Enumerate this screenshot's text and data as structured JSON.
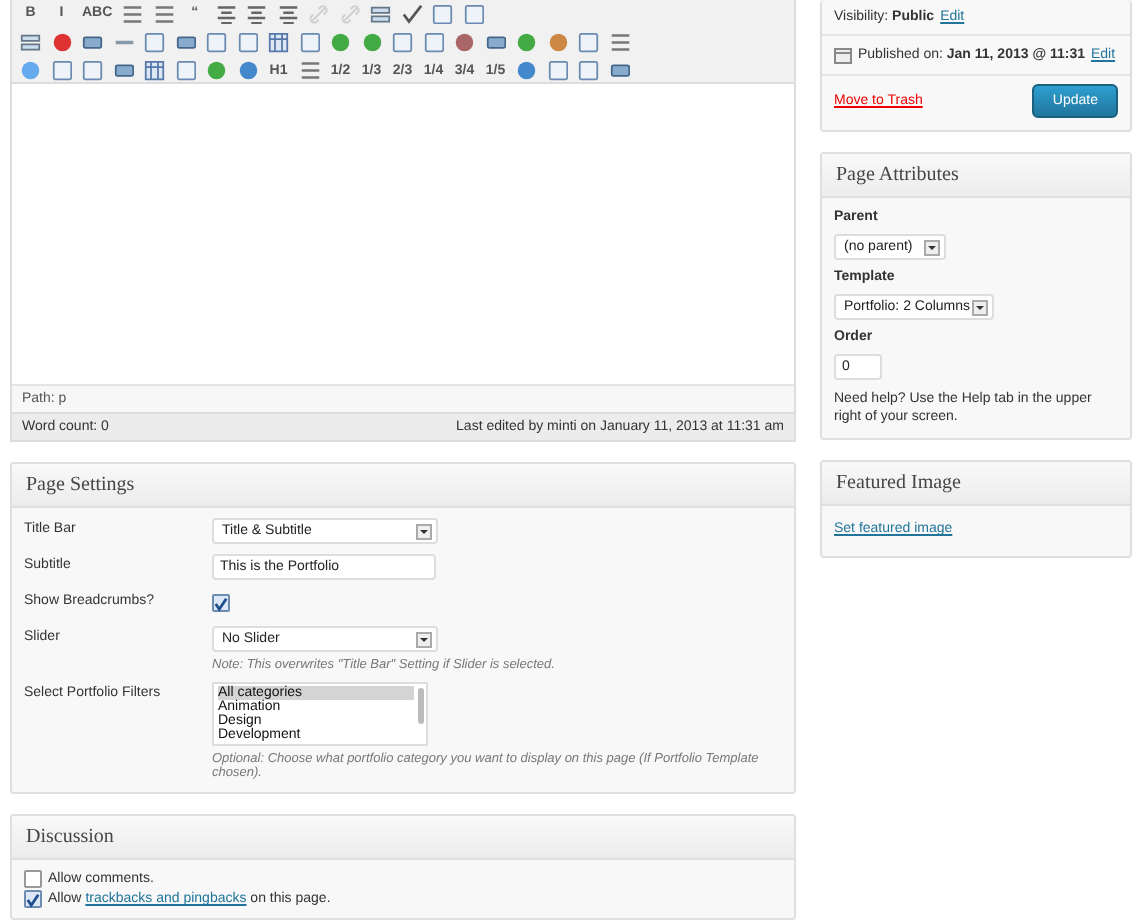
{
  "editor": {
    "toolbar": [
      [
        {
          "kind": "text",
          "label": "B"
        },
        {
          "kind": "text",
          "label": "I"
        },
        {
          "kind": "text",
          "label": "ABC"
        },
        {
          "kind": "icon"
        },
        {
          "kind": "icon"
        },
        {
          "kind": "text",
          "label": "“"
        },
        {
          "kind": "icon"
        },
        {
          "kind": "icon"
        },
        {
          "kind": "icon"
        },
        {
          "kind": "icon",
          "disabled": true
        },
        {
          "kind": "icon",
          "disabled": true
        },
        {
          "kind": "icon"
        },
        {
          "kind": "icon"
        },
        {
          "kind": "icon"
        },
        {
          "kind": "icon"
        }
      ],
      [
        {
          "kind": "icon"
        },
        {
          "kind": "icon"
        },
        {
          "kind": "icon"
        },
        {
          "kind": "icon"
        },
        {
          "kind": "icon"
        },
        {
          "kind": "icon"
        },
        {
          "kind": "icon"
        },
        {
          "kind": "icon"
        },
        {
          "kind": "icon"
        },
        {
          "kind": "icon"
        },
        {
          "kind": "icon"
        },
        {
          "kind": "icon"
        },
        {
          "kind": "icon"
        },
        {
          "kind": "icon"
        },
        {
          "kind": "icon"
        },
        {
          "kind": "icon"
        },
        {
          "kind": "icon"
        },
        {
          "kind": "icon"
        },
        {
          "kind": "icon"
        },
        {
          "kind": "icon"
        }
      ],
      [
        {
          "kind": "icon"
        },
        {
          "kind": "icon"
        },
        {
          "kind": "icon"
        },
        {
          "kind": "icon"
        },
        {
          "kind": "icon"
        },
        {
          "kind": "icon"
        },
        {
          "kind": "icon"
        },
        {
          "kind": "icon"
        },
        {
          "kind": "text",
          "label": "H1"
        },
        {
          "kind": "icon"
        },
        {
          "kind": "text",
          "label": "1/2"
        },
        {
          "kind": "text",
          "label": "1/3"
        },
        {
          "kind": "text",
          "label": "2/3"
        },
        {
          "kind": "text",
          "label": "1/4"
        },
        {
          "kind": "text",
          "label": "3/4"
        },
        {
          "kind": "text",
          "label": "1/5"
        },
        {
          "kind": "icon"
        },
        {
          "kind": "icon"
        },
        {
          "kind": "icon"
        },
        {
          "kind": "icon"
        }
      ]
    ],
    "path": "Path: p",
    "word_count": "Word count: 0",
    "last_edited": "Last edited by minti on January 11, 2013 at 11:31 am"
  },
  "page_settings": {
    "title": "Page Settings",
    "fields": [
      {
        "kind": "select",
        "label": "Title Bar",
        "value": "Title & Subtitle"
      },
      {
        "kind": "text",
        "label": "Subtitle",
        "value": "This is the Portfolio"
      },
      {
        "kind": "checkbox",
        "label": "Show Breadcrumbs?",
        "checked": true
      },
      {
        "kind": "select",
        "label": "Slider",
        "value": "No Slider",
        "note": "Note: This overwrites \"Title Bar\" Setting if Slider is selected."
      },
      {
        "kind": "listbox",
        "label": "Select Portfolio Filters",
        "options": [
          {
            "label": "All categories",
            "selected": true
          },
          {
            "label": "Animation",
            "selected": false
          },
          {
            "label": "Design",
            "selected": false
          },
          {
            "label": "Development",
            "selected": false
          }
        ],
        "note": "Optional: Choose what portfolio category you want to display on this page (If Portfolio Template chosen)."
      }
    ]
  },
  "discussion": {
    "title": "Discussion",
    "options": [
      {
        "before": "Allow comments.",
        "checked": false
      },
      {
        "before": "Allow ",
        "link": "trackbacks and pingbacks",
        "after": " on this page.",
        "checked": true
      }
    ]
  },
  "publish": {
    "visibility_label": "Visibility:",
    "visibility_value": "Public",
    "visibility_edit": "Edit",
    "published_label": "Published on:",
    "published_value": "Jan 11, 2013 @ 11:31",
    "published_edit": "Edit",
    "trash": "Move to Trash",
    "update": "Update"
  },
  "page_attributes": {
    "title": "Page Attributes",
    "parent_label": "Parent",
    "parent_value": "(no parent)",
    "template_label": "Template",
    "template_value": "Portfolio: 2 Columns",
    "order_label": "Order",
    "order_value": "0",
    "help": "Need help? Use the Help tab in the upper right of your screen."
  },
  "featured_image": {
    "title": "Featured Image",
    "link": "Set featured image"
  }
}
